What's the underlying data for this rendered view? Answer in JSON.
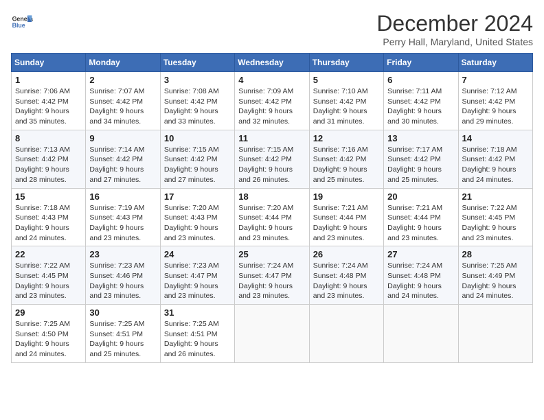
{
  "header": {
    "logo_line1": "General",
    "logo_line2": "Blue",
    "month_title": "December 2024",
    "location": "Perry Hall, Maryland, United States"
  },
  "weekdays": [
    "Sunday",
    "Monday",
    "Tuesday",
    "Wednesday",
    "Thursday",
    "Friday",
    "Saturday"
  ],
  "weeks": [
    [
      {
        "day": "1",
        "sunrise": "Sunrise: 7:06 AM",
        "sunset": "Sunset: 4:42 PM",
        "daylight": "Daylight: 9 hours and 35 minutes."
      },
      {
        "day": "2",
        "sunrise": "Sunrise: 7:07 AM",
        "sunset": "Sunset: 4:42 PM",
        "daylight": "Daylight: 9 hours and 34 minutes."
      },
      {
        "day": "3",
        "sunrise": "Sunrise: 7:08 AM",
        "sunset": "Sunset: 4:42 PM",
        "daylight": "Daylight: 9 hours and 33 minutes."
      },
      {
        "day": "4",
        "sunrise": "Sunrise: 7:09 AM",
        "sunset": "Sunset: 4:42 PM",
        "daylight": "Daylight: 9 hours and 32 minutes."
      },
      {
        "day": "5",
        "sunrise": "Sunrise: 7:10 AM",
        "sunset": "Sunset: 4:42 PM",
        "daylight": "Daylight: 9 hours and 31 minutes."
      },
      {
        "day": "6",
        "sunrise": "Sunrise: 7:11 AM",
        "sunset": "Sunset: 4:42 PM",
        "daylight": "Daylight: 9 hours and 30 minutes."
      },
      {
        "day": "7",
        "sunrise": "Sunrise: 7:12 AM",
        "sunset": "Sunset: 4:42 PM",
        "daylight": "Daylight: 9 hours and 29 minutes."
      }
    ],
    [
      {
        "day": "8",
        "sunrise": "Sunrise: 7:13 AM",
        "sunset": "Sunset: 4:42 PM",
        "daylight": "Daylight: 9 hours and 28 minutes."
      },
      {
        "day": "9",
        "sunrise": "Sunrise: 7:14 AM",
        "sunset": "Sunset: 4:42 PM",
        "daylight": "Daylight: 9 hours and 27 minutes."
      },
      {
        "day": "10",
        "sunrise": "Sunrise: 7:15 AM",
        "sunset": "Sunset: 4:42 PM",
        "daylight": "Daylight: 9 hours and 27 minutes."
      },
      {
        "day": "11",
        "sunrise": "Sunrise: 7:15 AM",
        "sunset": "Sunset: 4:42 PM",
        "daylight": "Daylight: 9 hours and 26 minutes."
      },
      {
        "day": "12",
        "sunrise": "Sunrise: 7:16 AM",
        "sunset": "Sunset: 4:42 PM",
        "daylight": "Daylight: 9 hours and 25 minutes."
      },
      {
        "day": "13",
        "sunrise": "Sunrise: 7:17 AM",
        "sunset": "Sunset: 4:42 PM",
        "daylight": "Daylight: 9 hours and 25 minutes."
      },
      {
        "day": "14",
        "sunrise": "Sunrise: 7:18 AM",
        "sunset": "Sunset: 4:42 PM",
        "daylight": "Daylight: 9 hours and 24 minutes."
      }
    ],
    [
      {
        "day": "15",
        "sunrise": "Sunrise: 7:18 AM",
        "sunset": "Sunset: 4:43 PM",
        "daylight": "Daylight: 9 hours and 24 minutes."
      },
      {
        "day": "16",
        "sunrise": "Sunrise: 7:19 AM",
        "sunset": "Sunset: 4:43 PM",
        "daylight": "Daylight: 9 hours and 23 minutes."
      },
      {
        "day": "17",
        "sunrise": "Sunrise: 7:20 AM",
        "sunset": "Sunset: 4:43 PM",
        "daylight": "Daylight: 9 hours and 23 minutes."
      },
      {
        "day": "18",
        "sunrise": "Sunrise: 7:20 AM",
        "sunset": "Sunset: 4:44 PM",
        "daylight": "Daylight: 9 hours and 23 minutes."
      },
      {
        "day": "19",
        "sunrise": "Sunrise: 7:21 AM",
        "sunset": "Sunset: 4:44 PM",
        "daylight": "Daylight: 9 hours and 23 minutes."
      },
      {
        "day": "20",
        "sunrise": "Sunrise: 7:21 AM",
        "sunset": "Sunset: 4:44 PM",
        "daylight": "Daylight: 9 hours and 23 minutes."
      },
      {
        "day": "21",
        "sunrise": "Sunrise: 7:22 AM",
        "sunset": "Sunset: 4:45 PM",
        "daylight": "Daylight: 9 hours and 23 minutes."
      }
    ],
    [
      {
        "day": "22",
        "sunrise": "Sunrise: 7:22 AM",
        "sunset": "Sunset: 4:45 PM",
        "daylight": "Daylight: 9 hours and 23 minutes."
      },
      {
        "day": "23",
        "sunrise": "Sunrise: 7:23 AM",
        "sunset": "Sunset: 4:46 PM",
        "daylight": "Daylight: 9 hours and 23 minutes."
      },
      {
        "day": "24",
        "sunrise": "Sunrise: 7:23 AM",
        "sunset": "Sunset: 4:47 PM",
        "daylight": "Daylight: 9 hours and 23 minutes."
      },
      {
        "day": "25",
        "sunrise": "Sunrise: 7:24 AM",
        "sunset": "Sunset: 4:47 PM",
        "daylight": "Daylight: 9 hours and 23 minutes."
      },
      {
        "day": "26",
        "sunrise": "Sunrise: 7:24 AM",
        "sunset": "Sunset: 4:48 PM",
        "daylight": "Daylight: 9 hours and 23 minutes."
      },
      {
        "day": "27",
        "sunrise": "Sunrise: 7:24 AM",
        "sunset": "Sunset: 4:48 PM",
        "daylight": "Daylight: 9 hours and 24 minutes."
      },
      {
        "day": "28",
        "sunrise": "Sunrise: 7:25 AM",
        "sunset": "Sunset: 4:49 PM",
        "daylight": "Daylight: 9 hours and 24 minutes."
      }
    ],
    [
      {
        "day": "29",
        "sunrise": "Sunrise: 7:25 AM",
        "sunset": "Sunset: 4:50 PM",
        "daylight": "Daylight: 9 hours and 24 minutes."
      },
      {
        "day": "30",
        "sunrise": "Sunrise: 7:25 AM",
        "sunset": "Sunset: 4:51 PM",
        "daylight": "Daylight: 9 hours and 25 minutes."
      },
      {
        "day": "31",
        "sunrise": "Sunrise: 7:25 AM",
        "sunset": "Sunset: 4:51 PM",
        "daylight": "Daylight: 9 hours and 26 minutes."
      },
      null,
      null,
      null,
      null
    ]
  ]
}
